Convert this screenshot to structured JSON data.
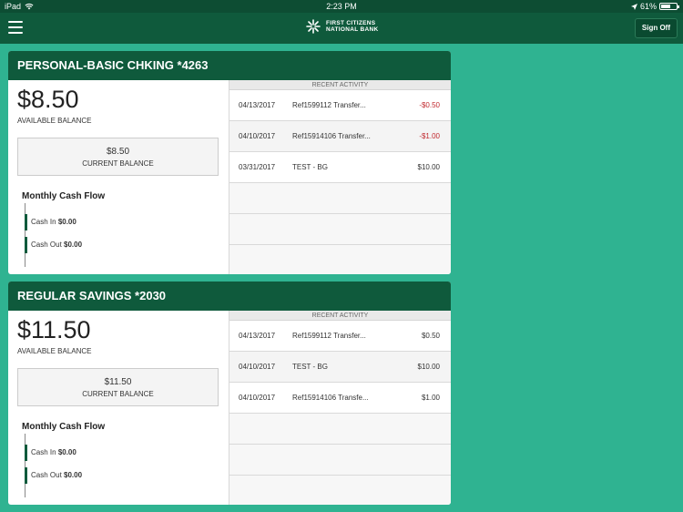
{
  "status_bar": {
    "device": "iPad",
    "time": "2:23 PM",
    "battery": "61%",
    "battery_level": 0.61
  },
  "header": {
    "bank_name_line1": "FIRST CITIZENS",
    "bank_name_line2": "NATIONAL BANK",
    "sign_off_label": "Sign Off",
    "menu_icon": "hamburger-menu-icon",
    "logo_icon": "bank-logo-icon"
  },
  "colors": {
    "primary": "#0f5a3c",
    "background": "#2fb391",
    "negative": "#c0282d"
  },
  "accounts": [
    {
      "name": "PERSONAL-BASIC CHKING *4263",
      "available_balance": "$8.50",
      "available_label": "AVAILABLE BALANCE",
      "current_balance": "$8.50",
      "current_label": "CURRENT BALANCE",
      "cash_flow_title": "Monthly Cash Flow",
      "cash_in_label": "Cash In",
      "cash_in_value": "$0.00",
      "cash_out_label": "Cash Out",
      "cash_out_value": "$0.00",
      "recent_activity_label": "RECENT ACTIVITY",
      "transactions": [
        {
          "date": "04/13/2017",
          "description": "Ref1599112 Transfer...",
          "amount": "-$0.50"
        },
        {
          "date": "04/10/2017",
          "description": "Ref15914106 Transfer...",
          "amount": "-$1.00"
        },
        {
          "date": "03/31/2017",
          "description": "TEST - BG",
          "amount": "$10.00"
        }
      ]
    },
    {
      "name": "REGULAR SAVINGS *2030",
      "available_balance": "$11.50",
      "available_label": "AVAILABLE BALANCE",
      "current_balance": "$11.50",
      "current_label": "CURRENT BALANCE",
      "cash_flow_title": "Monthly Cash Flow",
      "cash_in_label": "Cash In",
      "cash_in_value": "$0.00",
      "cash_out_label": "Cash Out",
      "cash_out_value": "$0.00",
      "recent_activity_label": "RECENT ACTIVITY",
      "transactions": [
        {
          "date": "04/13/2017",
          "description": "Ref1599112 Transfer...",
          "amount": "$0.50"
        },
        {
          "date": "04/10/2017",
          "description": "TEST - BG",
          "amount": "$10.00"
        },
        {
          "date": "04/10/2017",
          "description": "Ref15914106 Transfe...",
          "amount": "$1.00"
        }
      ]
    }
  ]
}
